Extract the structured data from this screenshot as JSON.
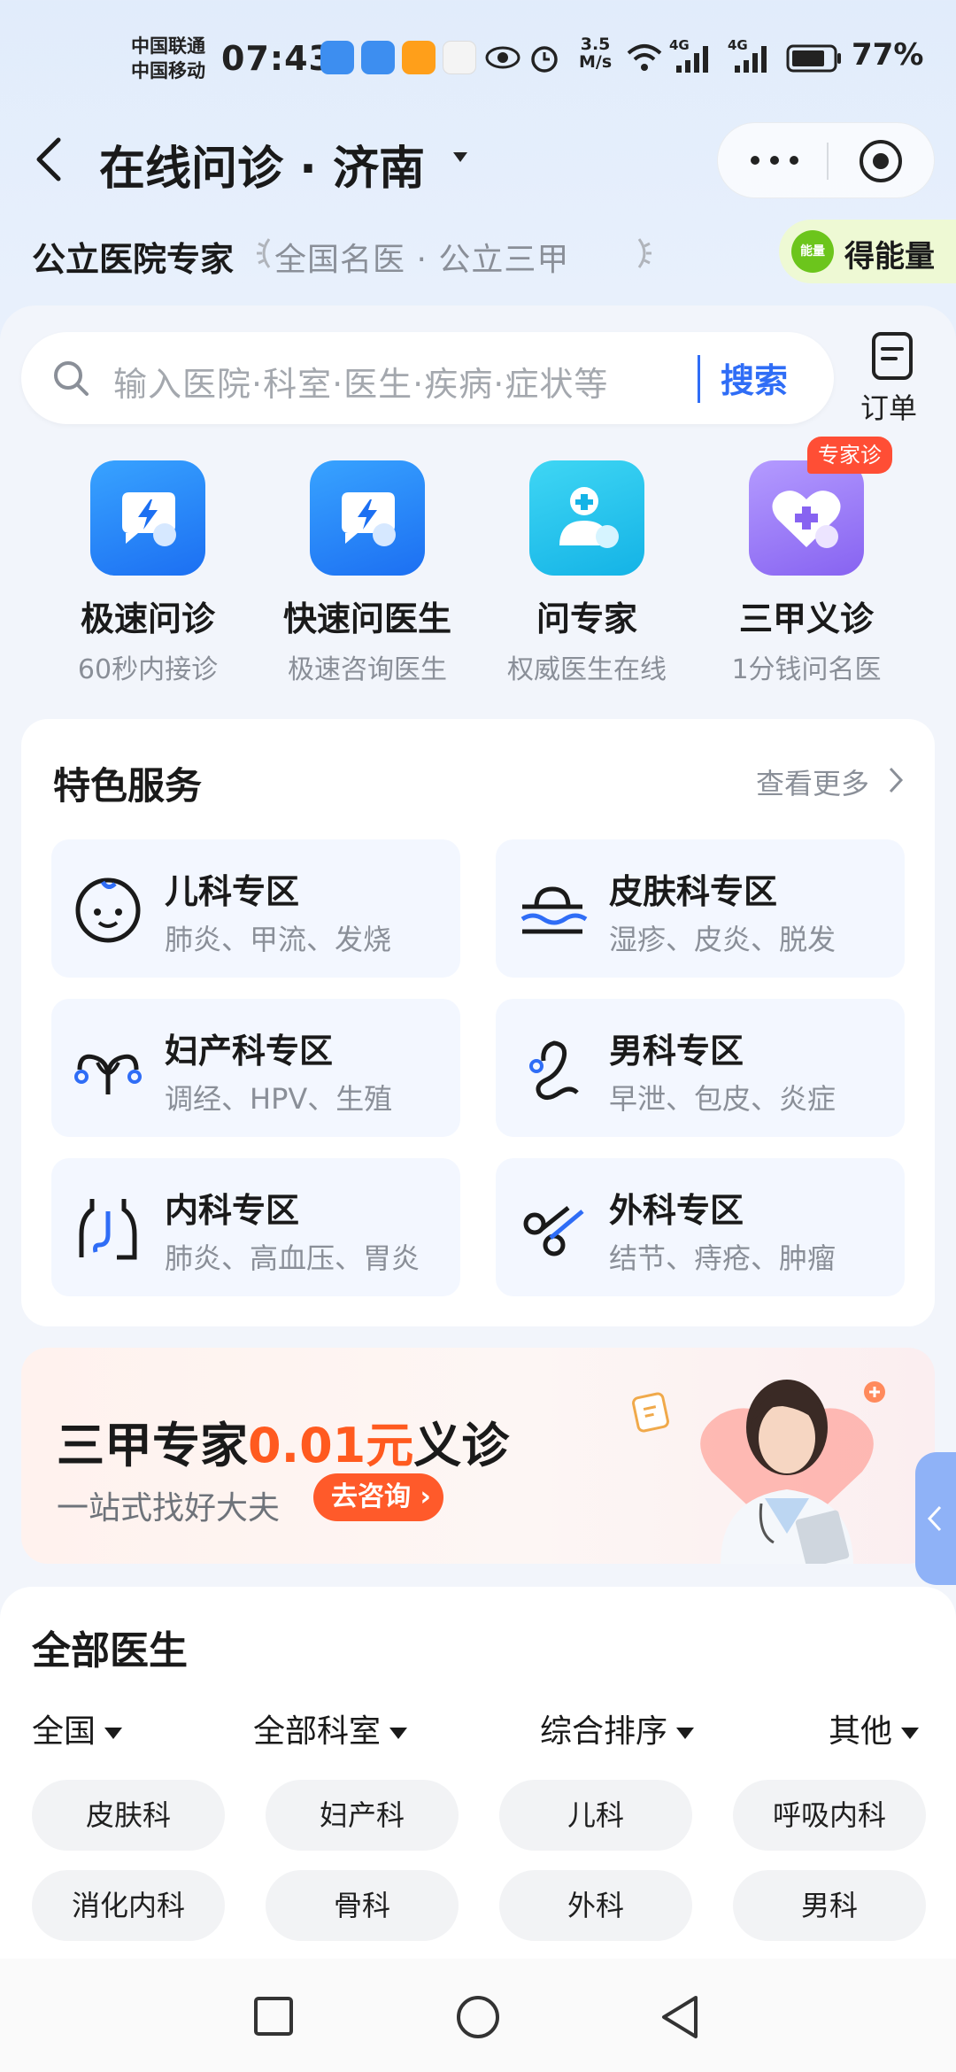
{
  "status_bar": {
    "carrier_1": "中国联通",
    "carrier_2": "中国移动",
    "time": "07:43",
    "speed_value": "3.5",
    "speed_unit": "M/s",
    "net_1": "4G",
    "net_2": "4G",
    "battery": "77%"
  },
  "header": {
    "title": "在线问诊 · 济南",
    "subtitle": "公立医院专家",
    "tags": "全国名医 · 公立三甲",
    "energy_badge": "能量",
    "energy_label": "得能量"
  },
  "search": {
    "placeholder": "输入医院·科室·医生·疾病·症状等",
    "button": "搜索",
    "order_label": "订单"
  },
  "quick_entries": [
    {
      "title": "极速问诊",
      "sub": "60秒内接诊",
      "icon": "lightning-chat-icon"
    },
    {
      "title": "快速问医生",
      "sub": "极速咨询医生",
      "icon": "lightning-chat-icon"
    },
    {
      "title": "问专家",
      "sub": "权威医生在线",
      "icon": "doctor-chat-icon"
    },
    {
      "title": "三甲义诊",
      "sub": "1分钱问名医",
      "icon": "heart-plus-icon"
    }
  ],
  "expert_badge": "专家诊",
  "services": {
    "title": "特色服务",
    "more": "查看更多",
    "items": [
      {
        "name": "儿科专区",
        "desc": "肺炎、甲流、发烧",
        "icon": "baby-face-icon"
      },
      {
        "name": "皮肤科专区",
        "desc": "湿疹、皮炎、脱发",
        "icon": "skin-layers-icon"
      },
      {
        "name": "妇产科专区",
        "desc": "调经、HPV、生殖",
        "icon": "uterus-icon"
      },
      {
        "name": "男科专区",
        "desc": "早泄、包皮、炎症",
        "icon": "male-organ-icon"
      },
      {
        "name": "内科专区",
        "desc": "肺炎、高血压、胃炎",
        "icon": "organs-icon"
      },
      {
        "name": "外科专区",
        "desc": "结节、痔疮、肿瘤",
        "icon": "scissors-icon"
      }
    ]
  },
  "promo": {
    "title_pre": "三甲专家",
    "title_highlight": "0.01元",
    "title_post": "义诊",
    "subtitle": "一站式找好大夫",
    "button": "去咨询"
  },
  "doctors": {
    "title": "全部医生",
    "filters": [
      "全国",
      "全部科室",
      "综合排序",
      "其他"
    ],
    "chips": [
      "皮肤科",
      "妇产科",
      "儿科",
      "呼吸内科",
      "消化内科",
      "骨科",
      "外科",
      "男科"
    ]
  },
  "colors": {
    "accent": "#2f6df6",
    "promo_highlight": "#ff5a1f",
    "badge": "#ff4e35"
  }
}
